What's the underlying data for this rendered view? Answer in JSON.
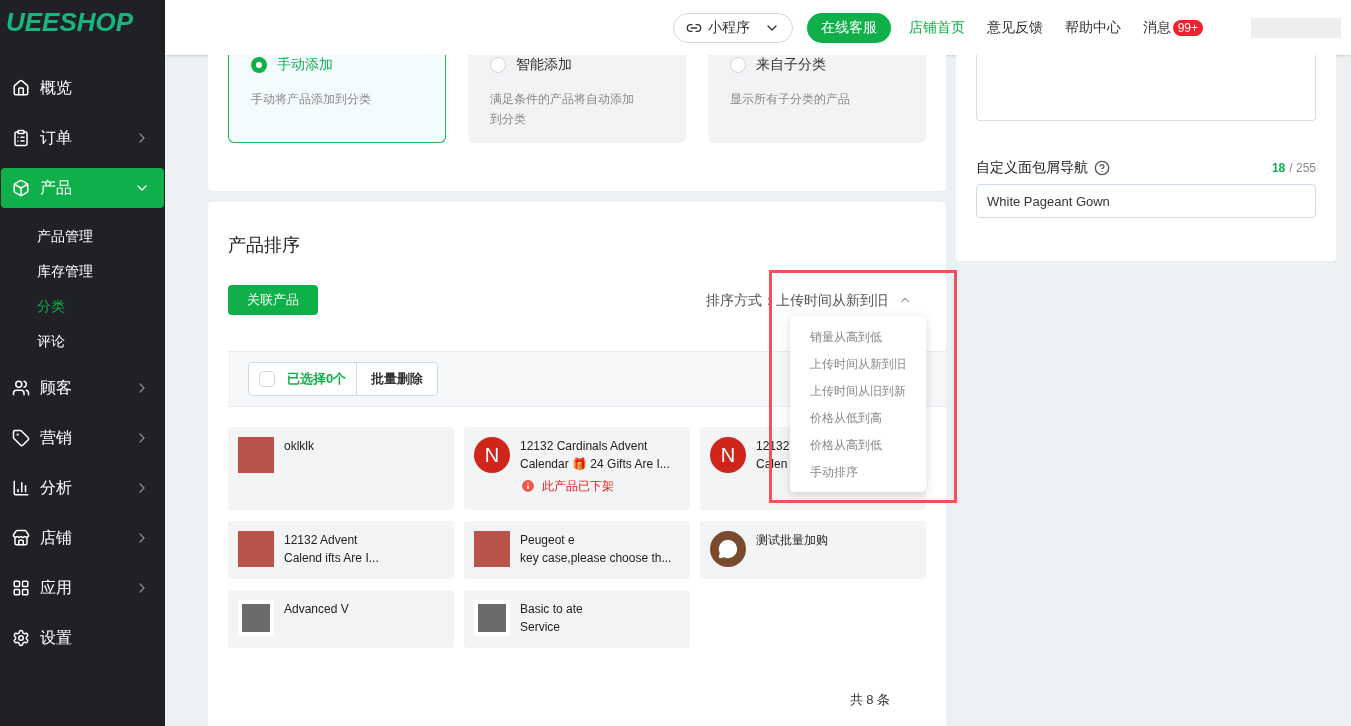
{
  "logo": "UEESHOP",
  "sidebar": {
    "items": [
      {
        "label": "概览",
        "selected": false
      },
      {
        "label": "订单",
        "selected": false,
        "expanded": false
      },
      {
        "label": "产品",
        "selected": true,
        "expanded": true,
        "children": [
          {
            "label": "产品管理",
            "selected": false
          },
          {
            "label": "库存管理",
            "selected": false
          },
          {
            "label": "分类",
            "selected": true
          },
          {
            "label": "评论",
            "selected": false
          }
        ]
      },
      {
        "label": "顾客",
        "selected": false,
        "expanded": false
      },
      {
        "label": "营销",
        "selected": false,
        "expanded": false
      },
      {
        "label": "分析",
        "selected": false,
        "expanded": false
      },
      {
        "label": "店铺",
        "selected": false,
        "expanded": false
      },
      {
        "label": "应用",
        "selected": false,
        "expanded": false
      },
      {
        "label": "设置",
        "selected": false
      }
    ]
  },
  "header": {
    "mini_program": "小程序",
    "support_button": "在线客服",
    "links": [
      {
        "label": "店铺首页",
        "selected": true
      },
      {
        "label": "意见反馈",
        "selected": false
      },
      {
        "label": "帮助中心",
        "selected": false
      }
    ],
    "messages": {
      "label": "消息",
      "badge": "99+"
    }
  },
  "add_modes": [
    {
      "title": "手动添加",
      "description": "手动将产品添加到分类",
      "selected": true
    },
    {
      "title": "智能添加",
      "description": "满足条件的产品将自动添加到分类",
      "selected": false
    },
    {
      "title": "来自子分类",
      "description": "显示所有子分类的产品",
      "selected": false
    }
  ],
  "breadcrumb": {
    "label": "自定义面包屑导航",
    "count": "18",
    "max": "/ 255",
    "value": "White Pageant Gown"
  },
  "sorting": {
    "title": "产品排序",
    "link_button": "关联产品",
    "sort_label": "排序方式：上传时间从新到旧",
    "options": [
      {
        "label": "销量从高到低"
      },
      {
        "label": "上传时间从新到旧"
      },
      {
        "label": "上传时间从旧到新"
      },
      {
        "label": "价格从低到高"
      },
      {
        "label": "价格从高到低"
      },
      {
        "label": "手动排序"
      }
    ],
    "selection": {
      "checked": false,
      "label": "已选择0个",
      "delete_button": "批量删除"
    },
    "products": [
      {
        "title": "oklklk",
        "kind": "photo"
      },
      {
        "title": "12132 Cardinals Advent\nCalendar 🎁 24 Gifts Are I...",
        "kind": "logo",
        "logo_text": "N",
        "status": "此产品已下架"
      },
      {
        "title": "12132\nCalen",
        "kind": "logo",
        "logo_text": "N"
      },
      {
        "title": "12132 Advent\nCalend ifts Are I...",
        "kind": "photo"
      },
      {
        "title": "Peugeot e\nkey case,please choose th...",
        "kind": "photo"
      },
      {
        "title": "测试批量加购",
        "kind": "chat"
      },
      {
        "title": "Advanced V",
        "kind": "device"
      },
      {
        "title": "Basic to ate\nService",
        "kind": "device"
      }
    ],
    "total": "共 8 条"
  }
}
